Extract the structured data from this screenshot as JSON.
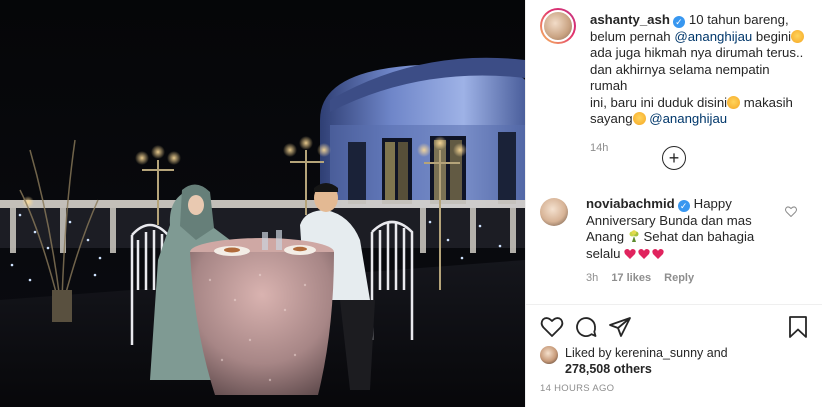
{
  "post": {
    "author": "ashanty_ash",
    "caption_line1": "10 tahun bareng,",
    "caption_line2a": "belum pernah ",
    "caption_mention1": "@ananghijau",
    "caption_line2b": " begini",
    "caption_line3": "ada juga hikmah nya dirumah terus..",
    "caption_line4": "dan akhirnya selama nempatin rumah",
    "caption_line5a": "ini, baru ini duduk disini",
    "caption_line5b": " makasih",
    "caption_line6a": "sayang",
    "caption_mention2": "@ananghijau",
    "caption_time": "14h"
  },
  "comment": {
    "author": "noviabachmid",
    "text_line1": "Happy",
    "text_line2": "Anniversary Bunda dan mas",
    "text_line3a": "Anang ",
    "text_line3b": " Sehat dan bahagia",
    "text_line4": "selalu ",
    "time": "3h",
    "likes": "17 likes",
    "reply": "Reply"
  },
  "likes": {
    "prefix": "Liked by ",
    "user": "kerenina_sunny",
    "middle": " and",
    "count": "278,508 others"
  },
  "timestamp": "14 HOURS AGO",
  "icons": {
    "add_comment": "plus-circle-icon",
    "like": "heart-icon",
    "comment": "comment-icon",
    "share": "share-icon",
    "save": "bookmark-icon",
    "verified": "verified-badge-icon"
  },
  "colors": {
    "mention": "#00376b",
    "verified": "#3897f0",
    "meta": "#8e8e8e",
    "heart_red": "#e0245e"
  }
}
